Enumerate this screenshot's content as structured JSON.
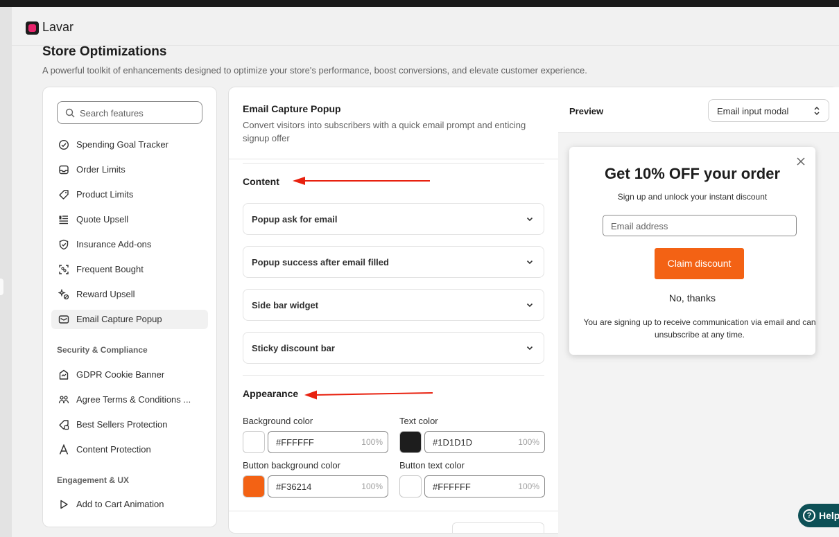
{
  "app": {
    "name": "Lavar"
  },
  "page": {
    "title": "Store Optimizations",
    "subtitle": "A powerful toolkit of enhancements designed to optimize your store's performance, boost conversions, and elevate customer experience."
  },
  "sidebar": {
    "search_placeholder": "Search features",
    "items": [
      {
        "label": "Spending Goal Tracker",
        "icon": "check-circle-icon"
      },
      {
        "label": "Order Limits",
        "icon": "inbox-icon"
      },
      {
        "label": "Product Limits",
        "icon": "tag-icon"
      },
      {
        "label": "Quote Upsell",
        "icon": "list-icon"
      },
      {
        "label": "Insurance Add-ons",
        "icon": "shield-check-icon"
      },
      {
        "label": "Frequent Bought",
        "icon": "scan-icon"
      },
      {
        "label": "Reward Upsell",
        "icon": "sparkle-icon"
      },
      {
        "label": "Email Capture Popup",
        "icon": "envelope-icon",
        "active": true
      }
    ],
    "section_security": "Security & Compliance",
    "security_items": [
      {
        "label": "GDPR Cookie Banner",
        "icon": "badge-icon"
      },
      {
        "label": "Agree Terms & Conditions ...",
        "icon": "people-icon"
      },
      {
        "label": "Best Sellers Protection",
        "icon": "lock-tag-icon"
      },
      {
        "label": "Content Protection",
        "icon": "text-a-icon"
      }
    ],
    "section_engagement": "Engagement & UX",
    "engagement_items": [
      {
        "label": "Add to Cart Animation",
        "icon": "play-icon"
      }
    ]
  },
  "config": {
    "title": "Email Capture Popup",
    "description": "Convert visitors into subscribers with a quick email prompt and enticing signup offer",
    "content_heading": "Content",
    "accordions": [
      "Popup ask for email",
      "Popup success after email filled",
      "Side bar widget",
      "Sticky discount bar"
    ],
    "appearance_heading": "Appearance",
    "colors": [
      {
        "label": "Background color",
        "hex": "#FFFFFF",
        "opacity": "100%",
        "swatch": "#FFFFFF"
      },
      {
        "label": "Text color",
        "hex": "#1D1D1D",
        "opacity": "100%",
        "swatch": "#1D1D1D"
      },
      {
        "label": "Button background color",
        "hex": "#F36214",
        "opacity": "100%",
        "swatch": "#F36214"
      },
      {
        "label": "Button text color",
        "hex": "#FFFFFF",
        "opacity": "100%",
        "swatch": "#FFFFFF"
      }
    ]
  },
  "preview": {
    "title": "Preview",
    "select_value": "Email input modal",
    "modal": {
      "heading": "Get 10% OFF your order",
      "subheading": "Sign up and unlock your instant discount",
      "email_placeholder": "Email address",
      "claim_label": "Claim discount",
      "decline_label": "No, thanks",
      "disclaimer": "You are signing up to receive communication via email and can unsubscribe at any time."
    }
  },
  "help": {
    "label": "Help"
  },
  "colors": {
    "accent": "#F36214",
    "annotation_arrow": "#e8210f",
    "help_bg": "#0d5056"
  }
}
